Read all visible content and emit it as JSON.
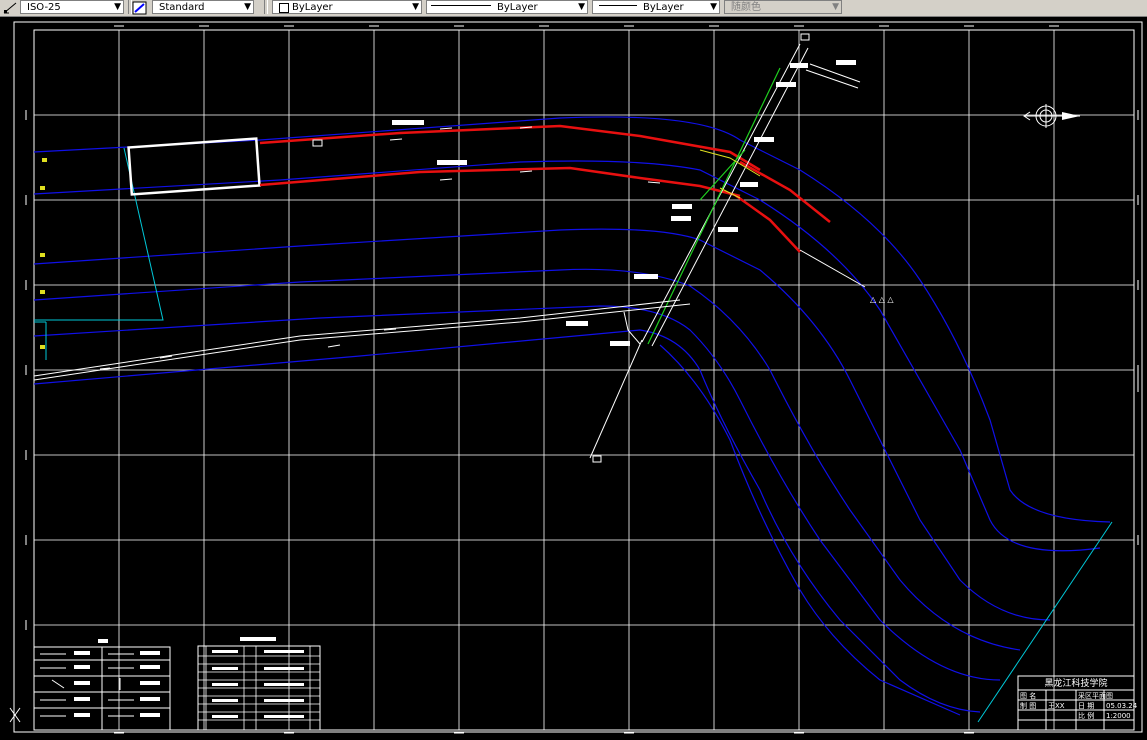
{
  "toolbar": {
    "dimstyle_value": "ISO-25",
    "textstyle_value": "Standard",
    "layer_value": "ByLayer",
    "linetype_value": "ByLayer",
    "lineweight_value": "ByLayer",
    "color_value": "随颜色"
  },
  "title_block": {
    "institute": "黑龙江科技学院",
    "row1_label": "图 名",
    "row1_value": "采区平面图",
    "row2_label": "制 图",
    "row2_value": "王XX",
    "row2_label2": "日 期",
    "row2_value2": "05.03.24",
    "row3_label": "比 例",
    "row3_value": "1:2000"
  },
  "legend": {
    "title": "图例"
  },
  "table": {
    "title": "巷道一览表"
  },
  "drawing": {
    "ucs_label": "X"
  }
}
